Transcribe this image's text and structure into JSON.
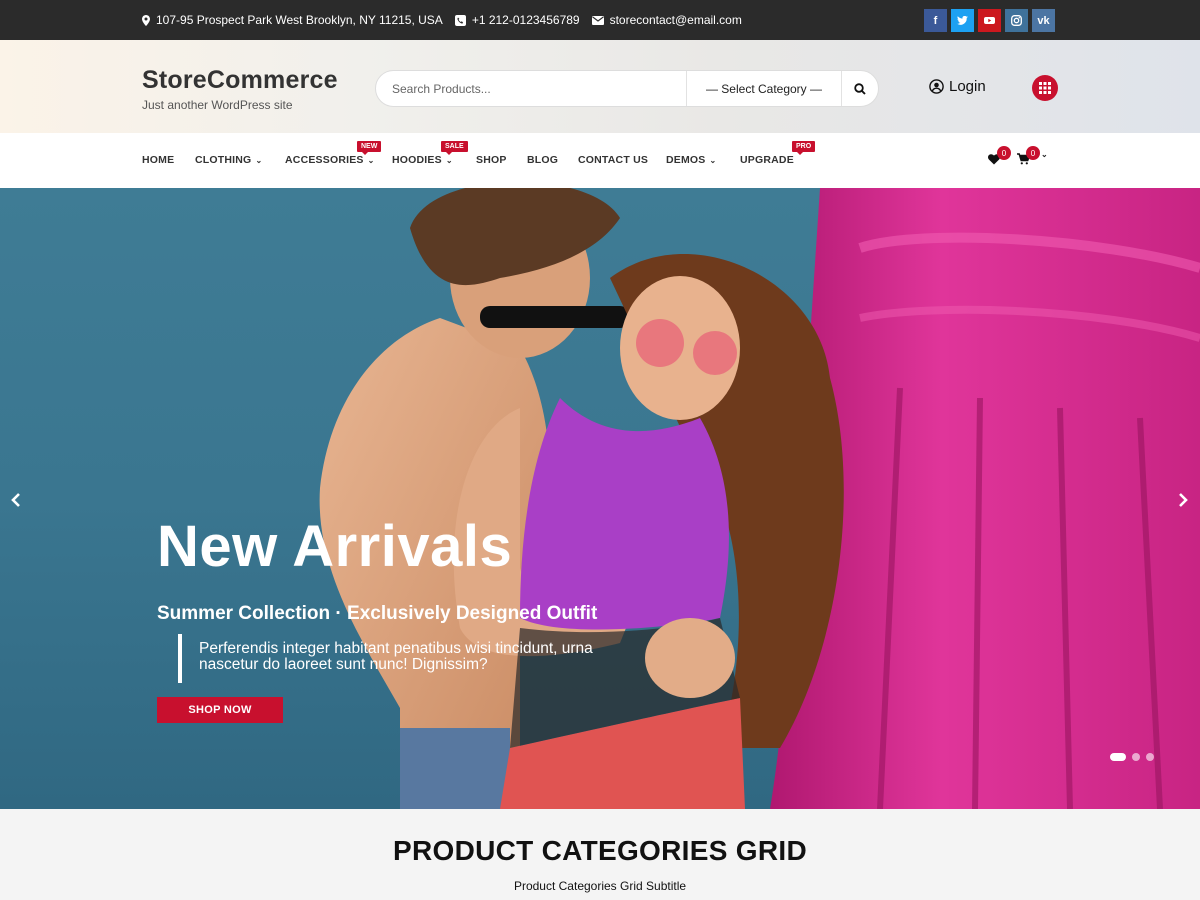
{
  "topbar": {
    "address": "107-95 Prospect Park West Brooklyn, NY 11215, USA",
    "phone": "+1 212-0123456789",
    "email": "storecontact@email.com",
    "social": [
      {
        "name": "facebook",
        "glyph": "f",
        "color": "#3b5998"
      },
      {
        "name": "twitter",
        "glyph": "t",
        "color": "#1da1f2"
      },
      {
        "name": "youtube",
        "glyph": "▶",
        "color": "#cc181e"
      },
      {
        "name": "instagram",
        "glyph": "◎",
        "color": "#3f729b"
      },
      {
        "name": "vk",
        "glyph": "vk",
        "color": "#4c75a3"
      }
    ]
  },
  "header": {
    "site_title": "StoreCommerce",
    "tagline": "Just another WordPress site",
    "search_placeholder": "Search Products...",
    "category_select": "— Select Category —",
    "login_label": "Login",
    "accent": "#c8102e"
  },
  "nav": {
    "items": [
      {
        "label": "HOME",
        "dropdown": false,
        "badge": ""
      },
      {
        "label": "CLOTHING",
        "dropdown": true,
        "badge": ""
      },
      {
        "label": "ACCESSORIES",
        "dropdown": true,
        "badge": "NEW"
      },
      {
        "label": "HOODIES",
        "dropdown": true,
        "badge": "SALE"
      },
      {
        "label": "SHOP",
        "dropdown": false,
        "badge": ""
      },
      {
        "label": "BLOG",
        "dropdown": false,
        "badge": ""
      },
      {
        "label": "CONTACT US",
        "dropdown": false,
        "badge": ""
      },
      {
        "label": "DEMOS",
        "dropdown": true,
        "badge": ""
      },
      {
        "label": "UPGRADE",
        "dropdown": false,
        "badge": "PRO"
      }
    ],
    "wishlist_count": "0",
    "cart_count": "0"
  },
  "hero": {
    "title": "New Arrivals",
    "subtitle": "Summer Collection · Exclusively Designed Outfit",
    "description": "Perferendis integer habitant penatibus wisi tincidunt, urna nascetur do laoreet sunt nunc! Dignissim?",
    "button_label": "SHOP NOW",
    "slides_total": 3,
    "active_slide": 1
  },
  "section": {
    "title": "PRODUCT CATEGORIES GRID",
    "subtitle": "Product Categories Grid Subtitle"
  }
}
